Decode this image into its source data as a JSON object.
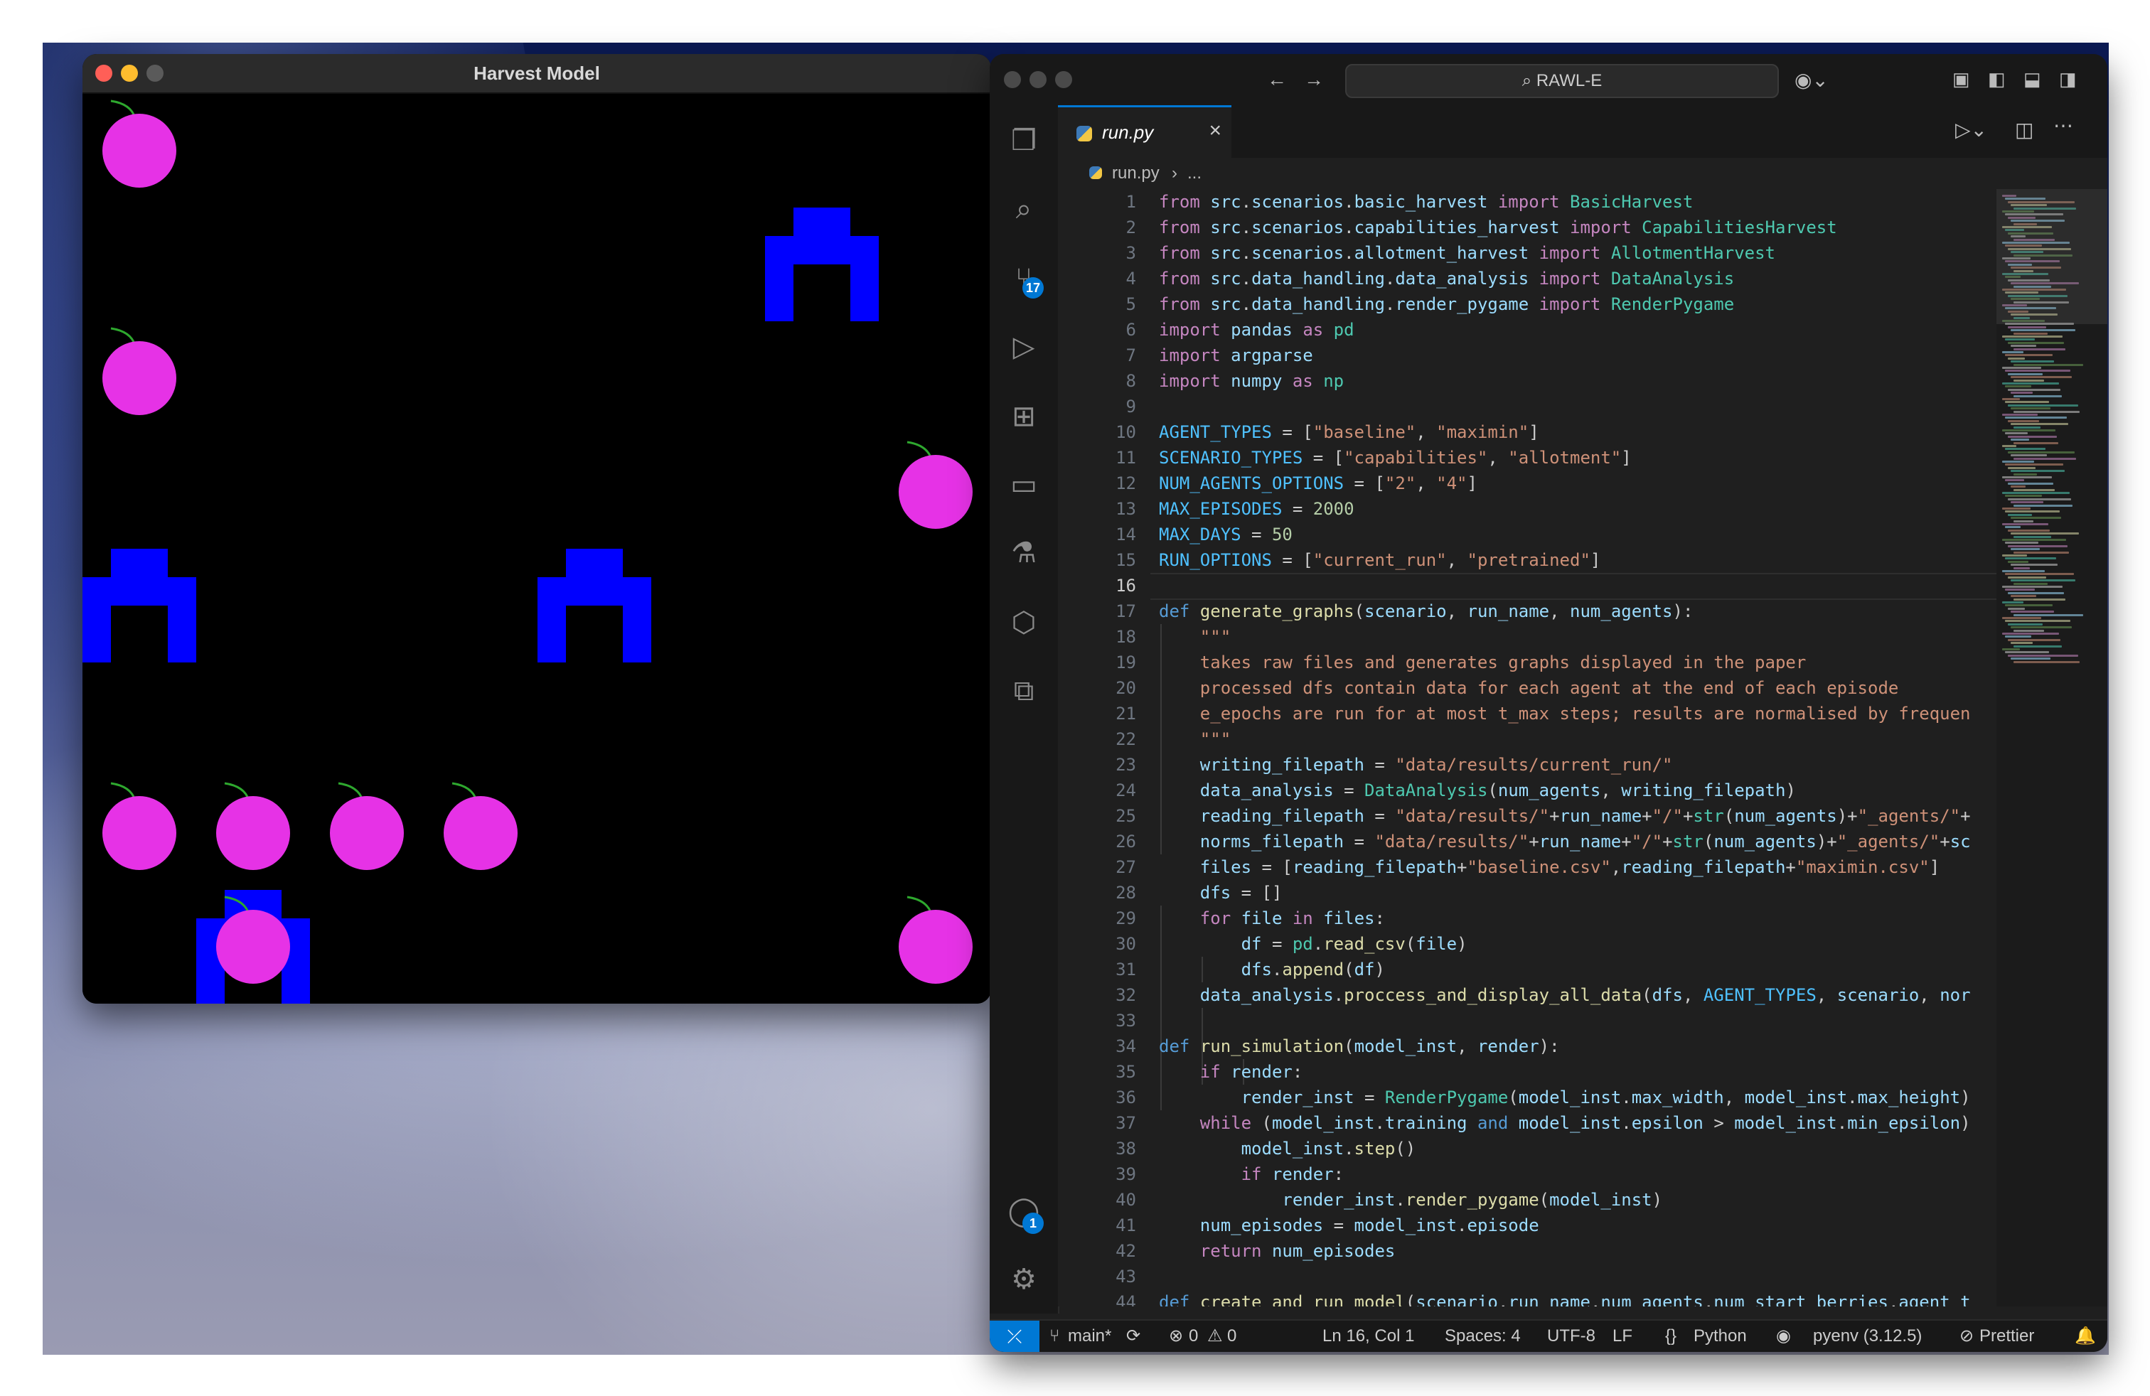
{
  "harvest_window": {
    "title": "Harvest Model",
    "colors": {
      "background": "#000000",
      "berry": "#e632e6",
      "stem": "#2ea82e",
      "agent": "#0000ff"
    }
  },
  "vscode": {
    "search_text": "RAWL-E",
    "tab": {
      "name": "run.py"
    },
    "breadcrumb": {
      "file": "run.py",
      "rest": "..."
    },
    "activity_badges": {
      "source_control": "17",
      "accounts": "1"
    },
    "current_line": 16,
    "code_lines": [
      "from src.scenarios.basic_harvest import BasicHarvest",
      "from src.scenarios.capabilities_harvest import CapabilitiesHarvest",
      "from src.scenarios.allotment_harvest import AllotmentHarvest",
      "from src.data_handling.data_analysis import DataAnalysis",
      "from src.data_handling.render_pygame import RenderPygame",
      "import pandas as pd",
      "import argparse",
      "import numpy as np",
      "",
      "AGENT_TYPES = [\"baseline\", \"maximin\"]",
      "SCENARIO_TYPES = [\"capabilities\", \"allotment\"]",
      "NUM_AGENTS_OPTIONS = [\"2\", \"4\"]",
      "MAX_EPISODES = 2000",
      "MAX_DAYS = 50",
      "RUN_OPTIONS = [\"current_run\", \"pretrained\"]",
      "",
      "def generate_graphs(scenario, run_name, num_agents):",
      "    \"\"\"",
      "    takes raw files and generates graphs displayed in the paper",
      "    processed dfs contain data for each agent at the end of each episode",
      "    e_epochs are run for at most t_max steps; results are normalised by frequen",
      "    \"\"\"",
      "    writing_filepath = \"data/results/current_run/\"",
      "    data_analysis = DataAnalysis(num_agents, writing_filepath)",
      "    reading_filepath = \"data/results/\"+run_name+\"/\"+str(num_agents)+\"_agents/\"+",
      "    norms_filepath = \"data/results/\"+run_name+\"/\"+str(num_agents)+\"_agents/\"+sc",
      "    files = [reading_filepath+\"baseline.csv\",reading_filepath+\"maximin.csv\"]",
      "    dfs = []",
      "    for file in files:",
      "        df = pd.read_csv(file)",
      "        dfs.append(df)",
      "    data_analysis.proccess_and_display_all_data(dfs, AGENT_TYPES, scenario, nor",
      "",
      "def run_simulation(model_inst, render):",
      "    if render:",
      "        render_inst = RenderPygame(model_inst.max_width, model_inst.max_height)",
      "    while (model_inst.training and model_inst.epsilon > model_inst.min_epsilon)",
      "        model_inst.step()",
      "        if render:",
      "            render_inst.render_pygame(model_inst)",
      "    num_episodes = model_inst.episode",
      "    return num_episodes",
      "",
      "def create_and_run_model(scenario,run_name,num_agents,num_start_berries,agent_t"
    ],
    "status_bar": {
      "branch": "main*",
      "errors": "0",
      "warnings": "0",
      "position": "Ln 16, Col 1",
      "spaces": "Spaces: 4",
      "encoding": "UTF-8",
      "eol": "LF",
      "language": "Python",
      "interpreter": "pyenv (3.12.5)",
      "formatter": "Prettier"
    }
  }
}
